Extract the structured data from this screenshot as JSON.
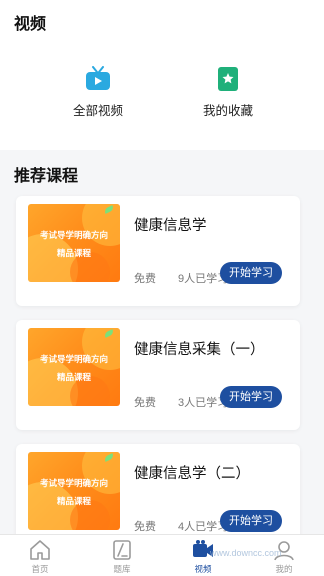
{
  "header": {
    "title": "视频"
  },
  "quick_links": [
    {
      "label": "全部视频",
      "icon": "tv-icon",
      "color": "#2aa9e0"
    },
    {
      "label": "我的收藏",
      "icon": "bookmark-star-icon",
      "color": "#1fb07a"
    }
  ],
  "section": {
    "title": "推荐课程"
  },
  "courses": [
    {
      "thumb_line1": "考试导学明确方向",
      "thumb_line2": "精品课程",
      "title": "健康信息学",
      "price": "免费",
      "learners": "9人已学习",
      "action": "开始学习"
    },
    {
      "thumb_line1": "考试导学明确方向",
      "thumb_line2": "精品课程",
      "title": "健康信息采集（一）",
      "price": "免费",
      "learners": "3人已学习",
      "action": "开始学习"
    },
    {
      "thumb_line1": "考试导学明确方向",
      "thumb_line2": "精品课程",
      "title": "健康信息学（二）",
      "price": "免费",
      "learners": "4人已学习",
      "action": "开始学习"
    }
  ],
  "tabbar": {
    "items": [
      {
        "label": "首页",
        "icon": "home-icon"
      },
      {
        "label": "题库",
        "icon": "question-bank-icon"
      },
      {
        "label": "视频",
        "icon": "video-camera-icon",
        "active": true
      },
      {
        "label": "我的",
        "icon": "user-icon"
      }
    ]
  },
  "watermark": "www.downcc.com",
  "colors": {
    "accent": "#1e4fa0",
    "thumb_orange": "#ff8c1a"
  }
}
